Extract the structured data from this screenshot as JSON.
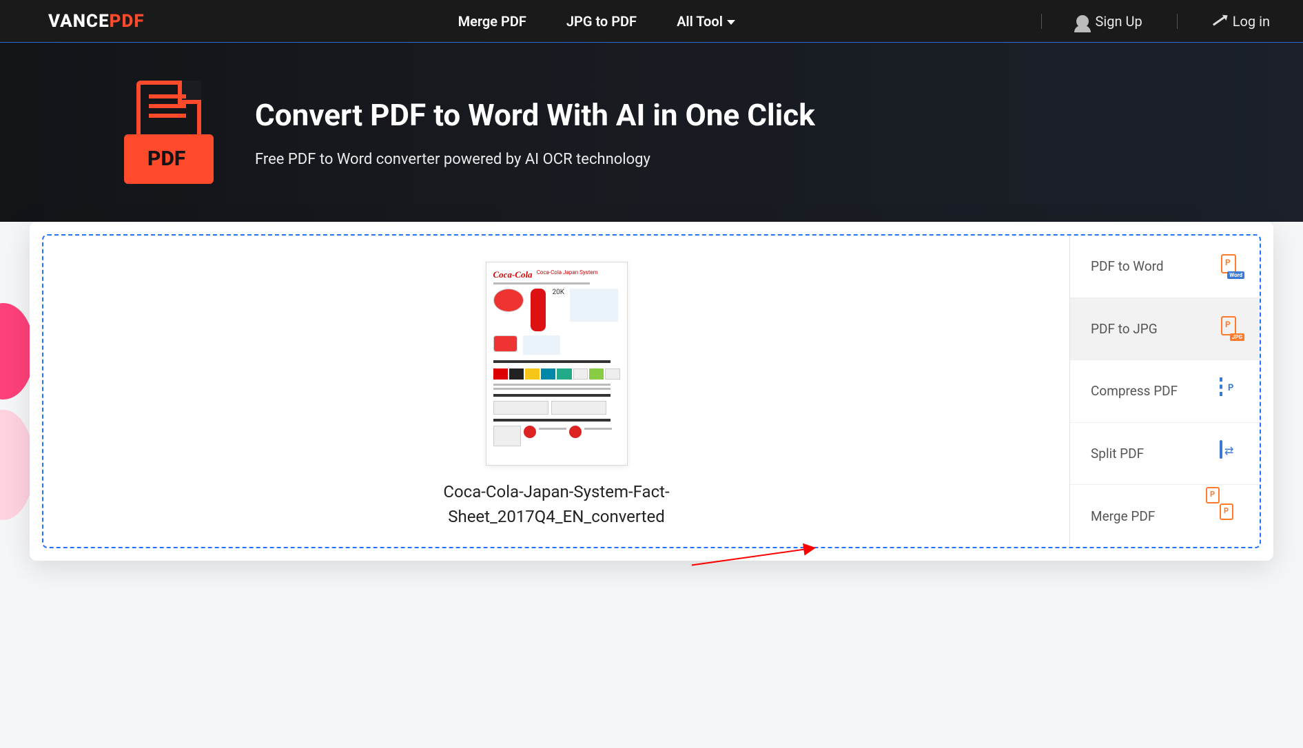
{
  "header": {
    "logo_white": "VANCE",
    "logo_red": "PDF",
    "nav": {
      "merge": "Merge PDF",
      "jpg": "JPG to PDF",
      "all": "All Tool"
    },
    "signup": "Sign Up",
    "login": "Log in"
  },
  "hero": {
    "pdf_badge": "PDF",
    "title": "Convert PDF to Word With AI in One Click",
    "subtitle": "Free PDF to Word converter powered by AI OCR technology"
  },
  "file": {
    "name": "Coca-Cola-Japan-System-Fact-Sheet_2017Q4_EN_converted",
    "thumb_brand": "Coca-Cola",
    "thumb_heading": "Coca-Cola Japan System"
  },
  "options": [
    {
      "label": "PDF to Word",
      "icon": "word",
      "active": false
    },
    {
      "label": "PDF to JPG",
      "icon": "jpg",
      "active": true
    },
    {
      "label": "Compress PDF",
      "icon": "compress",
      "active": false
    },
    {
      "label": "Split PDF",
      "icon": "split",
      "active": false
    },
    {
      "label": "Merge PDF",
      "icon": "merge",
      "active": false
    }
  ]
}
